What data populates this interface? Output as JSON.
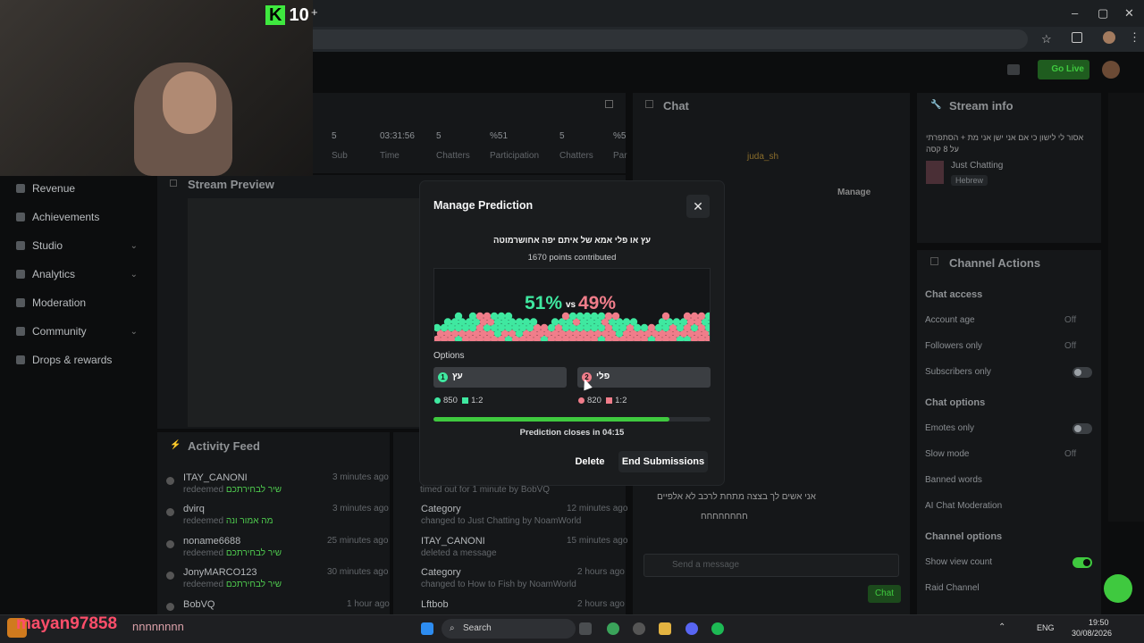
{
  "colors": {
    "accent_green": "#3fc93f",
    "option_a": "#3fe8a0",
    "option_b": "#f07d8a",
    "modal_bg": "#1a1c1e"
  },
  "webcam": {
    "brand": "10",
    "brand_plus": "+"
  },
  "browser": {
    "controls": [
      "–",
      "▢",
      "✕"
    ]
  },
  "header": {
    "go_live": "Go Live"
  },
  "sidebar": {
    "items": [
      "Revenue",
      "Achievements",
      "Studio",
      "Analytics",
      "Moderation",
      "Community",
      "Drops & rewards"
    ]
  },
  "stats_bar": {
    "items": [
      {
        "value": "5",
        "label": "Sub"
      },
      {
        "value": "03:31:56",
        "label": "Time"
      },
      {
        "value": "5",
        "label": "Chatters"
      },
      {
        "value": "%51",
        "label": "Participation"
      },
      {
        "value": "5",
        "label": "Chatters"
      },
      {
        "value": "%5",
        "label": "Par"
      }
    ]
  },
  "stream_preview": {
    "title": "Stream Preview"
  },
  "activity_feed": {
    "title": "Activity Feed",
    "items": [
      {
        "name": "ITAY_CANONI",
        "action": "redeemed",
        "reward": "שיר לבחירתכם",
        "time": "3 minutes ago"
      },
      {
        "name": "dvirq",
        "action": "redeemed",
        "reward": "מה אמור ונה",
        "time": "3 minutes ago"
      },
      {
        "name": "noname6688",
        "action": "redeemed",
        "reward": "שיר לבחירתכם",
        "time": "25 minutes ago"
      },
      {
        "name": "JonyMARCO123",
        "action": "redeemed",
        "reward": "שיר לבחירתכם",
        "time": "30 minutes ago"
      },
      {
        "name": "BobVQ",
        "action": "",
        "reward": "",
        "time": "1 hour ago"
      }
    ]
  },
  "mod_log": {
    "items": [
      {
        "title": "",
        "sub": "timed out for 1 minute by BobVQ",
        "time": ""
      },
      {
        "title": "Category",
        "sub": "changed to Just Chatting by NoamWorld",
        "time": "12 minutes ago"
      },
      {
        "title": "ITAY_CANONI",
        "sub": "deleted a message",
        "time": "15 minutes ago"
      },
      {
        "title": "Category",
        "sub": "changed to How to Fish by NoamWorld",
        "time": "2 hours ago"
      },
      {
        "title": "Lftbob",
        "sub": "",
        "time": "2 hours ago"
      }
    ]
  },
  "chat": {
    "title": "Chat",
    "pinned_user": "juda_sh",
    "manage": "Manage",
    "input_placeholder": "Send a message",
    "send": "Chat",
    "lines": [
      "אני אשים לך בצצה מתחת לרכב לא אלפיים",
      "חחחחחחחח"
    ]
  },
  "stream_info": {
    "title": "Stream info",
    "stream_title": "אסור לי לישון כי אם אני ישן אני מת + הסתפרתי על 8 קסה",
    "category": "Just Chatting",
    "tag": "Hebrew"
  },
  "channel_actions": {
    "title": "Channel Actions",
    "sections": [
      {
        "heading": "Chat access",
        "rows": [
          {
            "label": "Account age",
            "value": "Off"
          },
          {
            "label": "Followers only",
            "value": "Off"
          },
          {
            "label": "Subscribers only",
            "value": ""
          }
        ]
      },
      {
        "heading": "Chat options",
        "rows": [
          {
            "label": "Emotes only",
            "value": ""
          },
          {
            "label": "Slow mode",
            "value": "Off"
          },
          {
            "label": "Banned words",
            "value": ""
          },
          {
            "label": "AI Chat Moderation",
            "value": ""
          }
        ]
      },
      {
        "heading": "Channel options",
        "rows": [
          {
            "label": "Show view count",
            "value": ""
          },
          {
            "label": "Raid Channel",
            "value": ""
          }
        ]
      }
    ]
  },
  "modal": {
    "title": "Manage Prediction",
    "close": "✕",
    "question": "עץ או פלי אמא של איתם יפה אחושרמוטה",
    "points_contributed": "1670 points contributed",
    "percent_a": "51%",
    "vs": "vs",
    "percent_b": "49%",
    "options_label": "Options",
    "option_a": {
      "num": "1",
      "label": "עץ",
      "points": "850",
      "ratio": "1:2"
    },
    "option_b": {
      "num": "2",
      "label": "פלי",
      "points": "820",
      "ratio": "1:2"
    },
    "time_progress": 0.85,
    "closes_text": "Prediction closes in 04:15",
    "delete": "Delete",
    "end": "End Submissions"
  },
  "overlay_chat": {
    "user": "mayan97858",
    "msg": "nnnnnnnn"
  },
  "taskbar": {
    "search": "Search",
    "lang": "ENG",
    "time": "19:50",
    "date": "30/08/2026"
  }
}
